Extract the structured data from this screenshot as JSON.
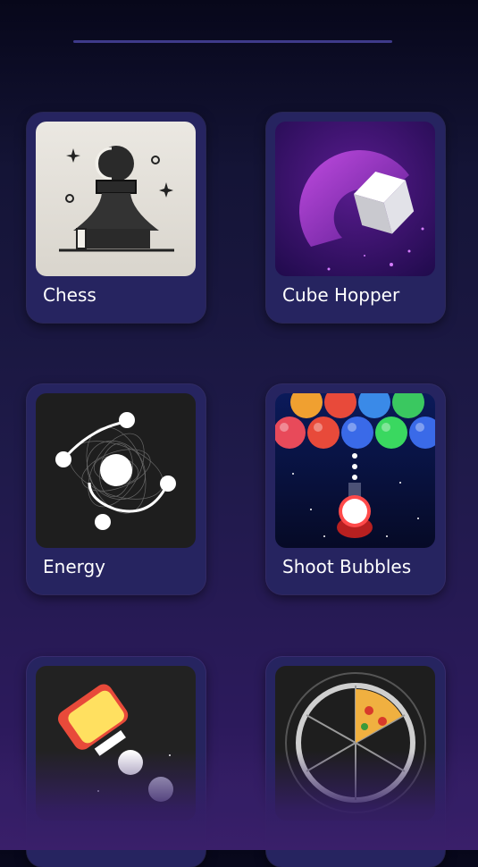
{
  "games": [
    {
      "label": "Chess",
      "icon": "chess-pawn-icon"
    },
    {
      "label": "Cube Hopper",
      "icon": "cube-icon"
    },
    {
      "label": "Energy",
      "icon": "orbit-icon"
    },
    {
      "label": "Shoot Bubbles",
      "icon": "bubble-shooter-icon"
    },
    {
      "label": "",
      "icon": "eraser-icon"
    },
    {
      "label": "",
      "icon": "pizza-wheel-icon"
    }
  ],
  "colors": {
    "card": "#262460",
    "background_top": "#07071a",
    "background_bottom": "#3a1f6a",
    "handle": "#3e3a8a"
  }
}
